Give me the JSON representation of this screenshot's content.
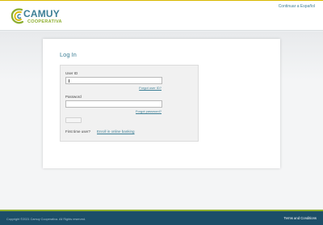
{
  "header": {
    "logo_name": "CAMUY",
    "logo_sub": "COOPERATIVA",
    "language_link": "Continuar a Español"
  },
  "login": {
    "title": "Log In",
    "user_id_label": "User ID",
    "user_id_value": "",
    "forgot_user_id": "Forgot user ID?",
    "password_label": "Password",
    "password_value": "",
    "forgot_password": "Forgot password?",
    "login_button": "",
    "first_time": "First time user?",
    "enroll_link": "Enroll in online banking"
  },
  "footer": {
    "copyright": "Copyright ©2021 Camuy Cooperativa. All Rights reserved.",
    "terms": "Terms and Conditions"
  },
  "colors": {
    "brand_teal": "#3d7f96",
    "brand_green": "#8dae2e",
    "footer_bg": "#1c4e68",
    "top_accent": "#d9b800"
  },
  "icons": {
    "logo_mark": "camuy-swirl-logo"
  }
}
